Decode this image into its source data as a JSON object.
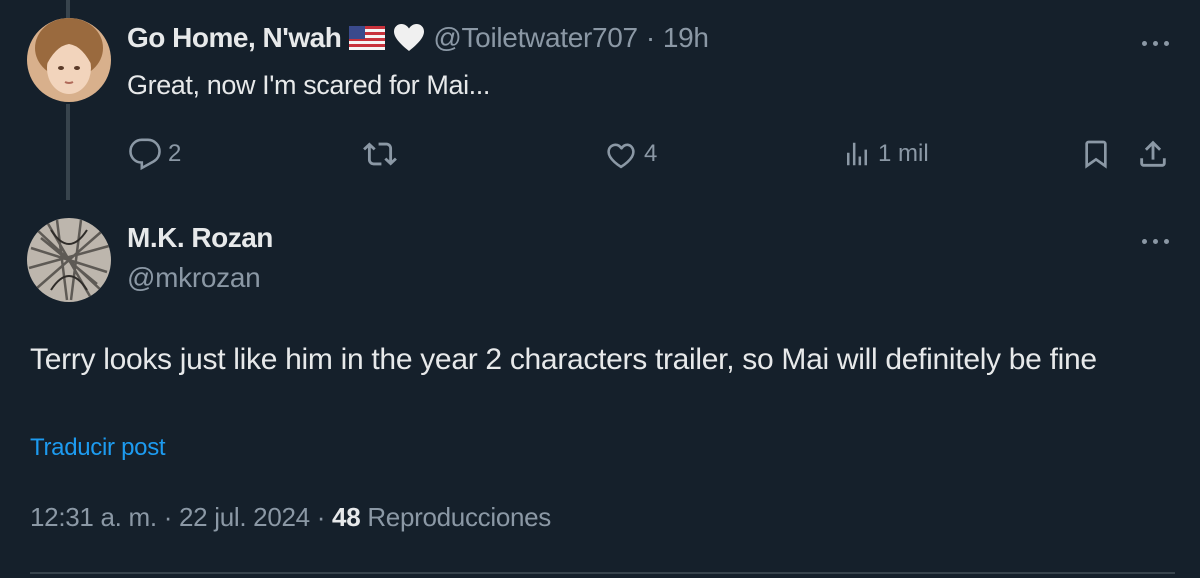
{
  "colors": {
    "background": "#15202b",
    "text_primary": "#e7e9ea",
    "text_secondary": "#8b98a5",
    "link": "#1d9bf0",
    "thread_line": "#38444d"
  },
  "tweet1": {
    "author_name": "Go Home, N'wah",
    "flag_icon": "us-flag-icon",
    "badge_icon": "white-heart-icon",
    "handle": "@Toiletwater707",
    "separator": "·",
    "time": "19h",
    "text": "Great, now I'm scared for Mai...",
    "actions": {
      "replies": "2",
      "retweets": "",
      "likes": "4",
      "views": "1 mil"
    }
  },
  "tweet2": {
    "author_name": "M.K. Rozan",
    "handle": "@mkrozan",
    "text": "Terry looks just like him in the year 2 characters trailer, so Mai will definitely be fine",
    "translate_label": "Traducir post",
    "timestamp": "12:31 a. m. · 22 jul. 2024 ·",
    "views_count": "48",
    "views_label": "Reproducciones"
  }
}
